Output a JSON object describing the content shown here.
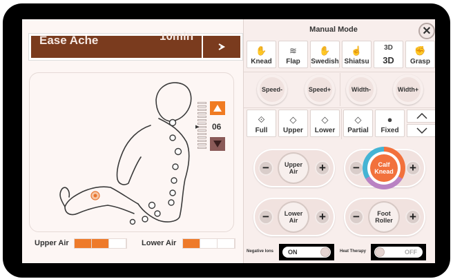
{
  "program": {
    "name": "Ease Ache",
    "time": "10min"
  },
  "level": {
    "value": "06"
  },
  "air_meters": [
    {
      "label": "Upper Air",
      "segments": 3,
      "active": 2
    },
    {
      "label": "Lower Air",
      "segments": 3,
      "active": 1
    }
  ],
  "manual": {
    "title": "Manual Mode",
    "techniques": [
      {
        "label": "Knead",
        "icon": "knead-icon"
      },
      {
        "label": "Flap",
        "icon": "flap-icon"
      },
      {
        "label": "Swedish",
        "icon": "swedish-icon"
      },
      {
        "label": "Shiatsu",
        "icon": "shiatsu-icon"
      },
      {
        "label": "3D",
        "icon": "3d-icon"
      },
      {
        "label": "Grasp",
        "icon": "grasp-icon"
      }
    ],
    "adjust": [
      "Speed-",
      "Speed+",
      "Width-",
      "Width+"
    ],
    "positions": [
      {
        "label": "Full",
        "icon": "full-icon"
      },
      {
        "label": "Upper",
        "icon": "upper-icon"
      },
      {
        "label": "Lower",
        "icon": "lower-icon"
      },
      {
        "label": "Partial",
        "icon": "partial-icon"
      },
      {
        "label": "Fixed",
        "icon": "fixed-icon"
      }
    ],
    "pills": [
      {
        "label1": "Upper",
        "label2": "Air"
      },
      {
        "label1": "Calf",
        "label2": "Knead"
      },
      {
        "label1": "Lower",
        "label2": "Air"
      },
      {
        "label1": "Foot",
        "label2": "Roller"
      }
    ],
    "toggles": [
      {
        "label": "Negative Ions",
        "state": "ON"
      },
      {
        "label": "Heat Therapy",
        "state": "OFF"
      }
    ]
  },
  "colors": {
    "accent": "#f07b22",
    "brown": "#7a3b1e",
    "calf_active": "#f2713c"
  }
}
